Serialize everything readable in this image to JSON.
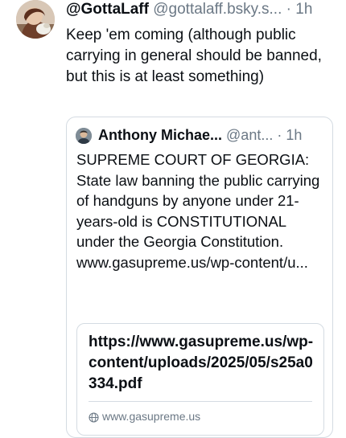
{
  "post": {
    "author": {
      "display_name": "@GottaLaff",
      "handle": "@gottalaff.bsky.s...",
      "time": "1h"
    },
    "separator": "·",
    "text": "Keep 'em coming (although public carrying in general should be banned, but this is at least something)"
  },
  "quote": {
    "author": {
      "display_name": "Anthony Michae...",
      "handle": "@ant...",
      "time": "1h"
    },
    "separator": "·",
    "text": "SUPREME COURT OF GEORGIA: State law banning the public carrying of handguns by anyone under 21-years-old is CONSTITUTIONAL under the Georgia Constitution. www.gasupreme.us/wp-content/u...",
    "link_card": {
      "title": "https://www.gasupreme.us/wp-content/uploads/2025/05/s25a0334.pdf",
      "domain": "www.gasupreme.us",
      "icon": "globe-icon"
    }
  },
  "colors": {
    "text": "#0b0f14",
    "muted": "#6b7885",
    "border": "#d4dbe2"
  }
}
